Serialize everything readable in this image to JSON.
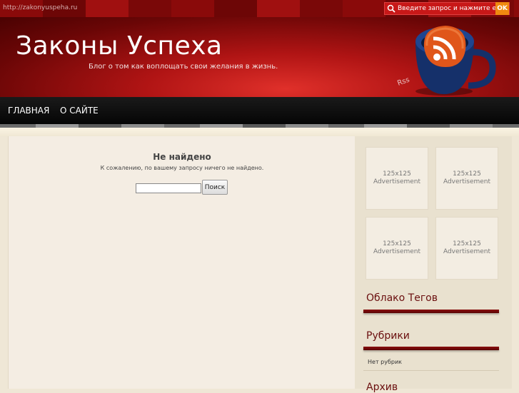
{
  "topbar": {
    "url": "http://zakonyuspeha.ru",
    "search_placeholder": "Введите запрос и нажмите enter",
    "ok_label": "OK"
  },
  "header": {
    "title": "Законы Успеха",
    "tagline": "Блог о том как воплощать свои желания в жизнь."
  },
  "nav": {
    "items": [
      {
        "label": "ГЛАВНАЯ"
      },
      {
        "label": "О САЙТЕ"
      }
    ]
  },
  "main": {
    "title": "Не найдено",
    "message": "К сожалению, по вашему запросу ничего не найдено.",
    "search_button": "Поиск"
  },
  "sidebar": {
    "ads": [
      {
        "line1": "125x125",
        "line2": "Advertisement"
      },
      {
        "line1": "125x125",
        "line2": "Advertisement"
      },
      {
        "line1": "125x125",
        "line2": "Advertisement"
      },
      {
        "line1": "125x125",
        "line2": "Advertisement"
      }
    ],
    "tag_cloud_title": "Облако Тегов",
    "categories_title": "Рубрики",
    "categories_empty": "Нет рубрик",
    "archive_title": "Архив"
  },
  "colors": {
    "accent": "#8b0e0e",
    "header_red": "#b01414",
    "ok_orange": "#f08a10"
  }
}
